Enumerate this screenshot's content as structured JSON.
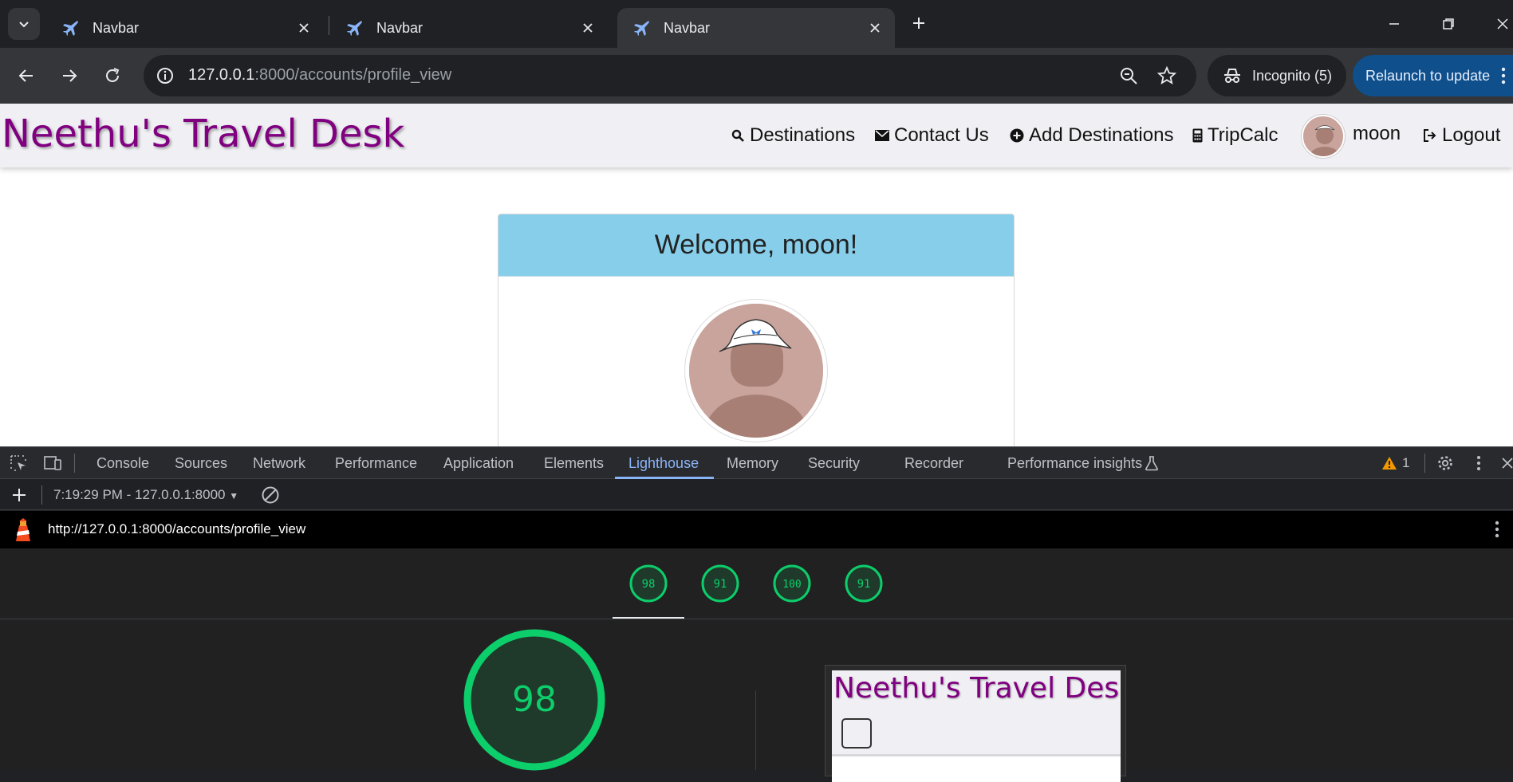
{
  "browser": {
    "tabs": [
      {
        "title": "Navbar",
        "active": false
      },
      {
        "title": "Navbar",
        "active": false
      },
      {
        "title": "Navbar",
        "active": true
      }
    ],
    "url_host": "127.0.0.1",
    "url_path": ":8000/accounts/profile_view",
    "incognito_label": "Incognito (5)",
    "relaunch_label": "Relaunch to update"
  },
  "site": {
    "brand": "Neethu's Travel Desk",
    "nav": {
      "destinations": "Destinations",
      "contact": "Contact Us",
      "add_destinations": "Add Destinations",
      "tripcalc": "TripCalc",
      "username": "moon",
      "logout": "Logout"
    },
    "card": {
      "welcome": "Welcome, moon!"
    }
  },
  "devtools": {
    "tabs": [
      "Console",
      "Sources",
      "Network",
      "Performance",
      "Application",
      "Elements",
      "Lighthouse",
      "Memory",
      "Security",
      "Recorder",
      "Performance insights"
    ],
    "active_tab": "Lighthouse",
    "warning_count": "1",
    "report_selector": "7:19:29 PM - 127.0.0.1:8000",
    "report_url": "http://127.0.0.1:8000/accounts/profile_view",
    "scores": [
      "98",
      "91",
      "100",
      "91"
    ],
    "main_score": "98",
    "thumbnail_brand": "Neethu's Travel Desk"
  },
  "colors": {
    "brand": "#800080",
    "card_header": "#87ceeb",
    "score_green": "#0cce6b",
    "devtools_accent": "#8ab4f8",
    "relaunch_bg": "#0e4f8c"
  }
}
